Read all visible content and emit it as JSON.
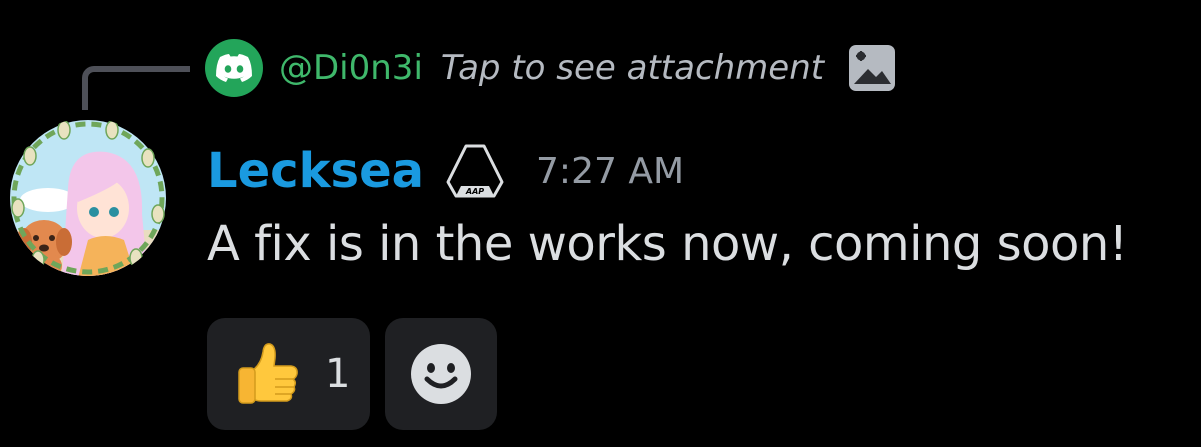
{
  "reply": {
    "author": "@Di0n3i",
    "text": "Tap to see attachment",
    "avatar_icon": "discord-logo-icon",
    "attachment_icon": "image-icon",
    "accent_color": "#23a55a"
  },
  "message": {
    "username": "Lecksea",
    "username_color": "#1a9ae0",
    "badge_icon": "server-tag-icon",
    "badge_text": "AAP",
    "timestamp": "7:27 AM",
    "content": "A fix is in the works now, coming soon!"
  },
  "reactions": [
    {
      "emoji": "thumbs-up-icon",
      "count": "1"
    },
    {
      "emoji": "add-reaction-icon"
    }
  ]
}
